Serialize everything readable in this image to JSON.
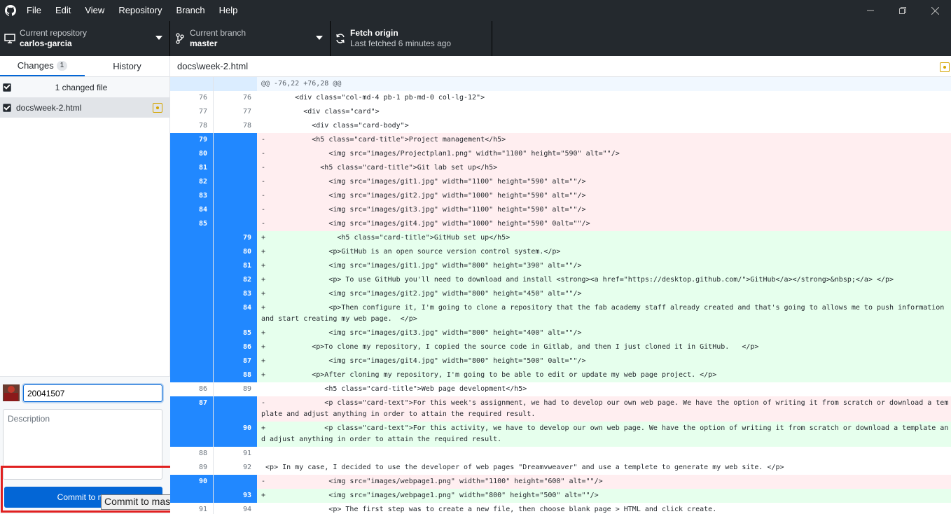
{
  "menu": [
    "File",
    "Edit",
    "View",
    "Repository",
    "Branch",
    "Help"
  ],
  "window_buttons": [
    "minimize-icon",
    "restore-icon",
    "close-icon"
  ],
  "toolbar": {
    "repo_label": "Current repository",
    "repo_value": "carlos-garcia",
    "branch_label": "Current branch",
    "branch_value": "master",
    "fetch_label": "Fetch origin",
    "fetch_sub": "Last fetched 6 minutes ago"
  },
  "sidebar": {
    "tab_changes": "Changes",
    "changes_count": "1",
    "tab_history": "History",
    "changed_files_label": "1 changed file",
    "file_path": "docs\\week-2.html"
  },
  "commit": {
    "summary_value": "20041507",
    "description_placeholder": "Description",
    "button_label": "Commit to ma",
    "tooltip": "Commit to master"
  },
  "diff": {
    "file_path": "docs\\week-2.html",
    "lines": [
      {
        "type": "hunk",
        "old": "",
        "new": "",
        "text": "@@ -76,22 +76,28 @@"
      },
      {
        "type": "ctx",
        "old": "76",
        "new": "76",
        "text": "        <div class=\"col-md-4 pb-1 pb-md-0 col-lg-12\">"
      },
      {
        "type": "ctx",
        "old": "77",
        "new": "77",
        "text": "          <div class=\"card\">"
      },
      {
        "type": "ctx",
        "old": "78",
        "new": "78",
        "text": "            <div class=\"card-body\">"
      },
      {
        "type": "del",
        "old": "79",
        "new": "",
        "text": "-           <h5 class=\"card-title\">Project management</h5>"
      },
      {
        "type": "del",
        "old": "80",
        "new": "",
        "text": "-               <img src=\"images/Projectplan1.png\" width=\"1100\" height=\"590\" alt=\"\"/>"
      },
      {
        "type": "del",
        "old": "81",
        "new": "",
        "text": "-             <h5 class=\"card-title\">Git lab set up</h5>"
      },
      {
        "type": "del",
        "old": "82",
        "new": "",
        "text": "-               <img src=\"images/git1.jpg\" width=\"1100\" height=\"590\" alt=\"\"/>"
      },
      {
        "type": "del",
        "old": "83",
        "new": "",
        "text": "-               <img src=\"images/git2.jpg\" width=\"1000\" height=\"590\" alt=\"\"/>"
      },
      {
        "type": "del",
        "old": "84",
        "new": "",
        "text": "-               <img src=\"images/git3.jpg\" width=\"1100\" height=\"590\" alt=\"\"/>"
      },
      {
        "type": "del",
        "old": "85",
        "new": "",
        "text": "-               <img src=\"images/git4.jpg\" width=\"1000\" height=\"590\" 0alt=\"\"/>"
      },
      {
        "type": "add",
        "old": "",
        "new": "79",
        "text": "+                 <h5 class=\"card-title\">GitHub set up</h5>"
      },
      {
        "type": "add",
        "old": "",
        "new": "80",
        "text": "+               <p>GitHub is an open source version control system.</p>"
      },
      {
        "type": "add",
        "old": "",
        "new": "81",
        "text": "+               <img src=\"images/git1.jpg\" width=\"800\" height=\"390\" alt=\"\"/>"
      },
      {
        "type": "add",
        "old": "",
        "new": "82",
        "text": "+               <p> To use GitHub you'll need to download and install <strong><a href=\"https://desktop.github.com/\">GitHub</a></strong>&nbsp;</a> </p>"
      },
      {
        "type": "add",
        "old": "",
        "new": "83",
        "text": "+               <img src=\"images/git2.jpg\" width=\"800\" height=\"450\" alt=\"\"/>"
      },
      {
        "type": "add",
        "old": "",
        "new": "84",
        "text": "+               <p>Then configure it, I'm going to clone a repository that the fab academy staff already created and that's going to allows me to push information and start creating my web page.  </p>",
        "tall": true
      },
      {
        "type": "add",
        "old": "",
        "new": "85",
        "text": "+               <img src=\"images/git3.jpg\" width=\"800\" height=\"400\" alt=\"\"/>"
      },
      {
        "type": "add",
        "old": "",
        "new": "86",
        "text": "+           <p>To clone my repository, I copied the source code in Gitlab, and then I just cloned it in GitHub.   </p>"
      },
      {
        "type": "add",
        "old": "",
        "new": "87",
        "text": "+               <img src=\"images/git4.jpg\" width=\"800\" height=\"500\" 0alt=\"\"/>"
      },
      {
        "type": "add",
        "old": "",
        "new": "88",
        "text": "+           <p>After cloning my repository, I'm going to be able to edit or update my web page project. </p>"
      },
      {
        "type": "ctx",
        "old": "86",
        "new": "89",
        "text": "               <h5 class=\"card-title\">Web page development</h5>"
      },
      {
        "type": "del",
        "old": "87",
        "new": "",
        "text": "-              <p class=\"card-text\">For this week's assignment, we had to develop our own web page. We have the option of writing it from scratch or download a template and adjust anything in order to attain the required result.",
        "tall": true
      },
      {
        "type": "add",
        "old": "",
        "new": "90",
        "text": "+              <p class=\"card-text\">For this activity, we have to develop our own web page. We have the option of writing it from scratch or download a template and adjust anything in order to attain the required result.",
        "tall": true
      },
      {
        "type": "ctx",
        "old": "88",
        "new": "91",
        "text": ""
      },
      {
        "type": "ctx",
        "old": "89",
        "new": "92",
        "text": " <p> In my case, I decided to use the developer of web pages \"Dreamvweaver\" and use a templete to generate my web site. </p>"
      },
      {
        "type": "del",
        "old": "90",
        "new": "",
        "text": "-               <img src=\"images/webpage1.png\" width=\"1100\" height=\"600\" alt=\"\"/>"
      },
      {
        "type": "add",
        "old": "",
        "new": "93",
        "text": "+               <img src=\"images/webpage1.png\" width=\"800\" height=\"500\" alt=\"\"/>"
      },
      {
        "type": "ctx",
        "old": "91",
        "new": "94",
        "text": "                <p> The first step was to create a new file, then choose blank page > HTML and click create."
      }
    ]
  }
}
